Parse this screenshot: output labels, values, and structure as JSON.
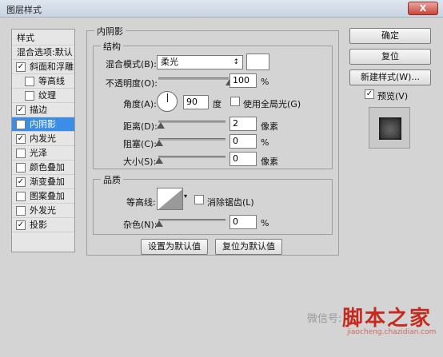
{
  "window": {
    "title": "图层样式",
    "close_label": "X"
  },
  "style_list": {
    "items": [
      {
        "label": "样式",
        "checked": null,
        "selected": false,
        "indent": false
      },
      {
        "label": "混合选项:默认",
        "checked": null,
        "selected": false,
        "indent": false
      },
      {
        "label": "斜面和浮雕",
        "checked": true,
        "selected": false,
        "indent": false
      },
      {
        "label": "等高线",
        "checked": false,
        "selected": false,
        "indent": true
      },
      {
        "label": "纹理",
        "checked": false,
        "selected": false,
        "indent": true
      },
      {
        "label": "描边",
        "checked": true,
        "selected": false,
        "indent": false
      },
      {
        "label": "内阴影",
        "checked": true,
        "selected": true,
        "indent": false
      },
      {
        "label": "内发光",
        "checked": true,
        "selected": false,
        "indent": false
      },
      {
        "label": "光泽",
        "checked": false,
        "selected": false,
        "indent": false
      },
      {
        "label": "颜色叠加",
        "checked": false,
        "selected": false,
        "indent": false
      },
      {
        "label": "渐变叠加",
        "checked": true,
        "selected": false,
        "indent": false
      },
      {
        "label": "图案叠加",
        "checked": false,
        "selected": false,
        "indent": false
      },
      {
        "label": "外发光",
        "checked": false,
        "selected": false,
        "indent": false
      },
      {
        "label": "投影",
        "checked": true,
        "selected": false,
        "indent": false
      }
    ]
  },
  "inner_shadow": {
    "panel_title": "内阴影",
    "structure": {
      "title": "结构",
      "blend_mode_label": "混合模式(B):",
      "blend_mode_value": "柔光",
      "opacity_label": "不透明度(O):",
      "opacity_value": "100",
      "opacity_level": 1.0,
      "opacity_unit": "%",
      "angle_label": "角度(A):",
      "angle_value": "90",
      "angle_unit": "度",
      "global_light_label": "使用全局光(G)",
      "global_light_checked": false,
      "distance_label": "距离(D):",
      "distance_value": "2",
      "distance_level": 0.02,
      "distance_unit": "像素",
      "choke_label": "阻塞(C):",
      "choke_value": "0",
      "choke_level": 0.0,
      "choke_unit": "%",
      "size_label": "大小(S):",
      "size_value": "0",
      "size_level": 0.0,
      "size_unit": "像素"
    },
    "quality": {
      "title": "品质",
      "contour_label": "等高线:",
      "antialias_label": "消除锯齿(L)",
      "antialias_checked": false,
      "noise_label": "杂色(N):",
      "noise_value": "0",
      "noise_level": 0.0,
      "noise_unit": "%"
    },
    "set_default_label": "设置为默认值",
    "reset_default_label": "复位为默认值"
  },
  "right_buttons": {
    "ok_label": "确定",
    "reset_label": "复位",
    "new_style_label": "新建样式(W)...",
    "preview_label": "预览(V)",
    "preview_checked": true
  },
  "watermark": {
    "wechat_text": "微信号:",
    "site_text": "脚本之家",
    "url_text": "jiaocheng.chazidian.com"
  },
  "check_mark": "✓"
}
